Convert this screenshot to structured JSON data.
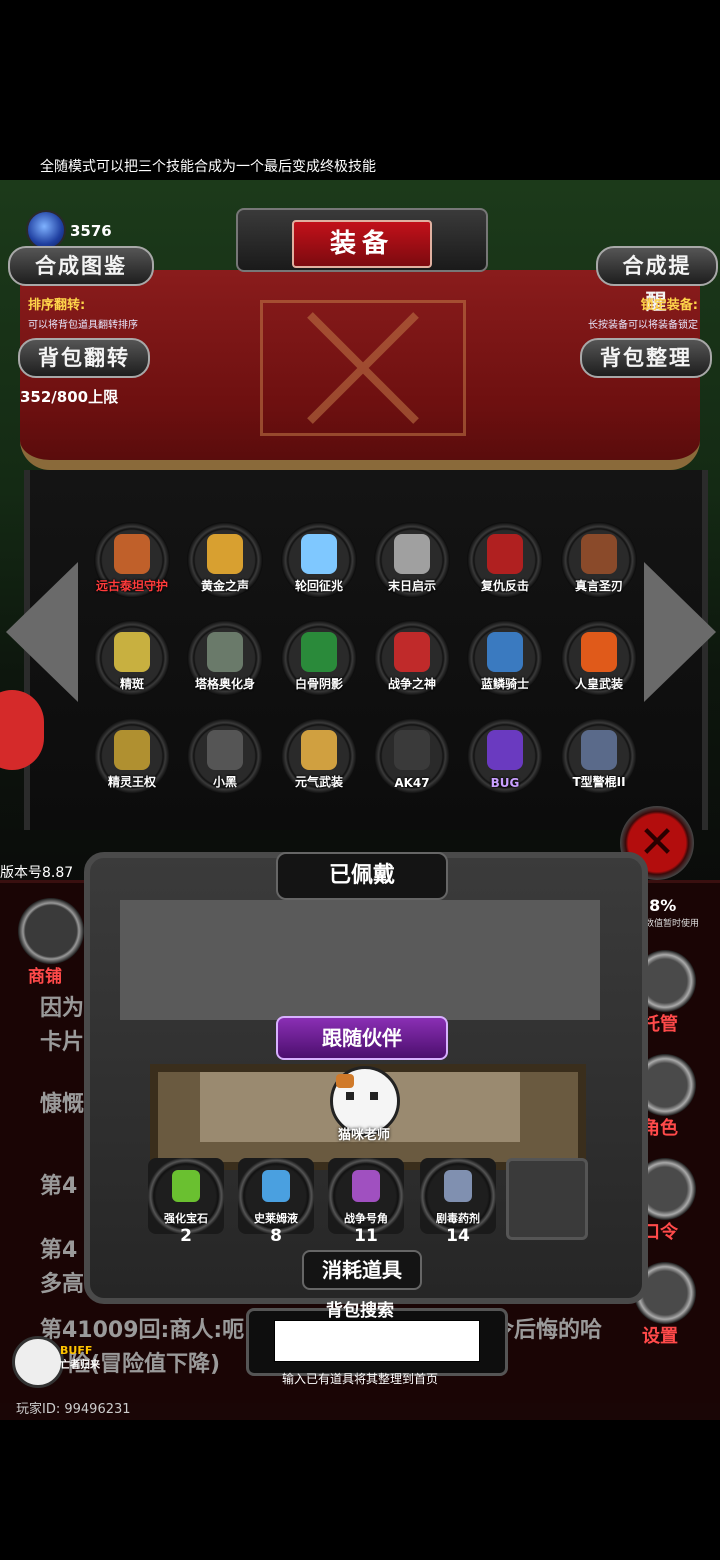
{
  "hint_text": "全随模式可以把三个技能合成为一个最后变成终极技能",
  "currency": {
    "icon": "blue-gem-icon",
    "amount": "3576"
  },
  "title": "装备",
  "buttons": {
    "synth_catalog": "合成图鉴",
    "synth_remind": "合成提醒",
    "bag_flip": "背包翻转",
    "bag_sort": "背包整理"
  },
  "notes": {
    "sort_title": "排序翻转:",
    "sort_desc": "可以将背包道具翻转排序",
    "lock_title": "锁定装备:",
    "lock_desc": "长按装备可以将装备锁定"
  },
  "capacity": "352/800上限",
  "equipment": [
    {
      "name": "远古泰坦守护",
      "color": "#c0602a",
      "name_color": "#ff3b3b"
    },
    {
      "name": "黄金之声",
      "color": "#d8a030",
      "name_color": "#ffffff"
    },
    {
      "name": "轮回征兆",
      "color": "#7fc8ff",
      "name_color": "#ffffff"
    },
    {
      "name": "末日启示",
      "color": "#a0a0a0",
      "name_color": "#ffffff"
    },
    {
      "name": "复仇反击",
      "color": "#b02020",
      "name_color": "#ffffff"
    },
    {
      "name": "真言圣刃",
      "color": "#8a4a2a",
      "name_color": "#ffffff"
    },
    {
      "name": "精斑",
      "color": "#c8b040",
      "name_color": "#ffffff"
    },
    {
      "name": "塔格奥化身",
      "color": "#6a7a6a",
      "name_color": "#ffffff"
    },
    {
      "name": "白骨阴影",
      "color": "#2a8a3a",
      "name_color": "#ffffff"
    },
    {
      "name": "战争之神",
      "color": "#c02a2a",
      "name_color": "#ffffff"
    },
    {
      "name": "蓝鳞骑士",
      "color": "#3a7ac0",
      "name_color": "#ffffff"
    },
    {
      "name": "人皇武装",
      "color": "#e05a1a",
      "name_color": "#ffffff"
    },
    {
      "name": "精灵王权",
      "color": "#b09030",
      "name_color": "#ffffff"
    },
    {
      "name": "小黑",
      "color": "#555555",
      "name_color": "#ffffff"
    },
    {
      "name": "元气武装",
      "color": "#d0a040",
      "name_color": "#ffffff"
    },
    {
      "name": "AK47",
      "color": "#3a3a3a",
      "name_color": "#ffffff"
    },
    {
      "name": "BUG",
      "color": "#6a3ac0",
      "name_color": "#c9a0ff"
    },
    {
      "name": "T型警棍II",
      "color": "#5a6a8a",
      "name_color": "#ffffff"
    }
  ],
  "version": "版本号8.87",
  "percent": "78%",
  "percent_note": "其数值暂时使用",
  "shop_label": "商铺",
  "side_labels": [
    "托管",
    "角色",
    "口令",
    "设置"
  ],
  "log_lines": [
    "因为",
    "卡片",
    "慷慨的",
    "第4",
    "第4",
    "多高",
    "第41009回:商人:呃",
    "令后悔的哈",
    "险(冒险值下降)"
  ],
  "equipped_title": "已佩戴",
  "companion_title": "跟随伙伴",
  "companion_name": "猫咪老师",
  "consumables_title": "消耗道具",
  "consumables": [
    {
      "name": "强化宝石",
      "count": "2",
      "color": "#6ac030"
    },
    {
      "name": "史莱姆液",
      "count": "8",
      "color": "#4aa0e0"
    },
    {
      "name": "战争号角",
      "count": "11",
      "color": "#a050c0"
    },
    {
      "name": "剧毒药剂",
      "count": "14",
      "color": "#8090b0"
    }
  ],
  "search": {
    "title": "背包搜索",
    "value": "",
    "hint": "输入已有道具将其整理到首页"
  },
  "buff": {
    "label": "BUFF",
    "name": "亡者归来"
  },
  "player_id": "玩家ID: 99496231"
}
